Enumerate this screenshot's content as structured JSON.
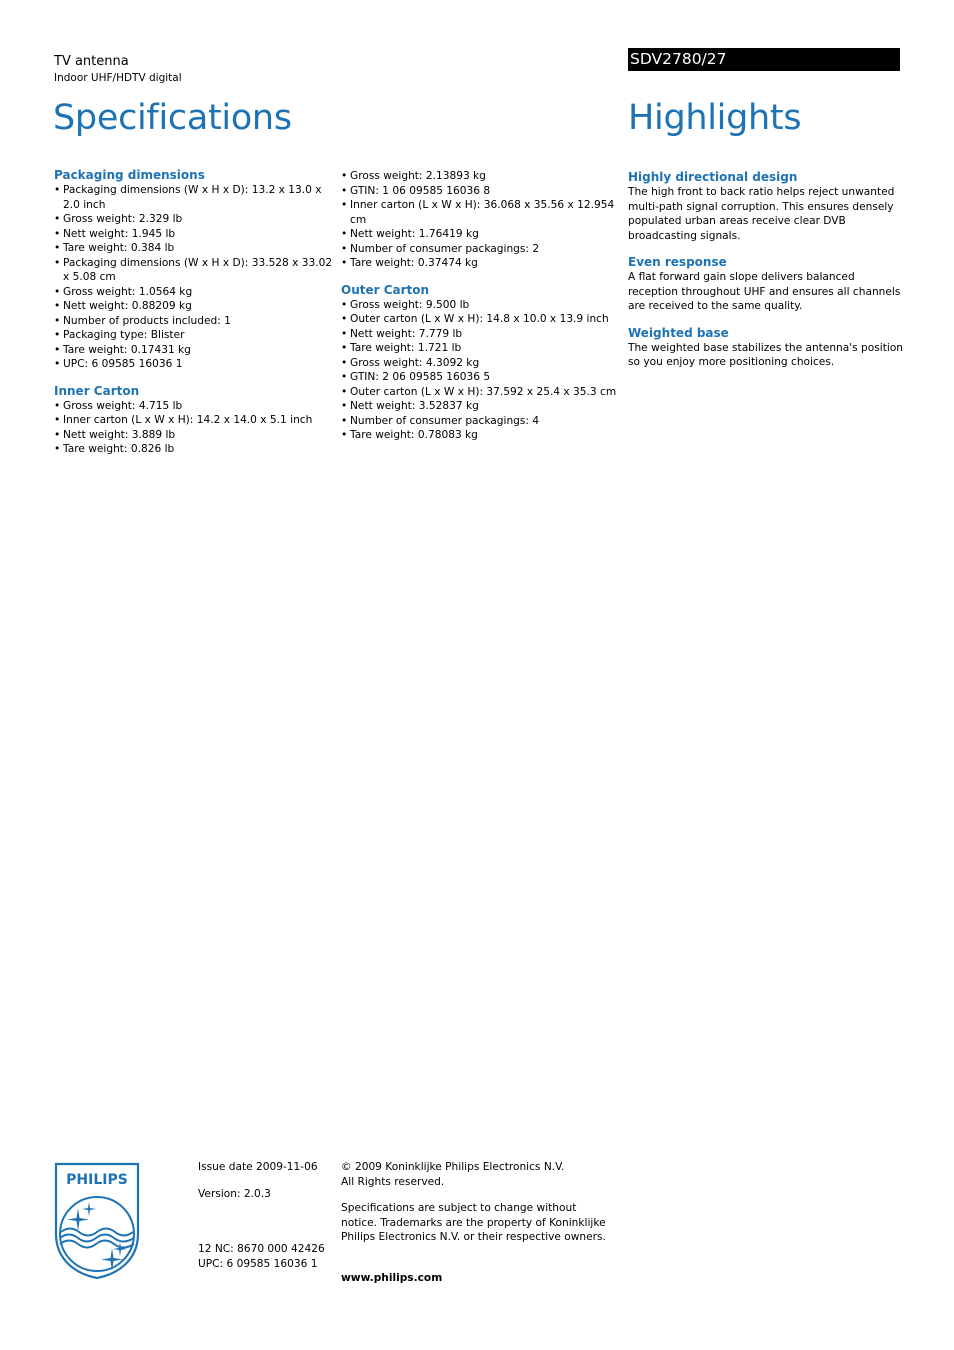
{
  "header": {
    "product_name": "TV antenna",
    "product_subtitle": "Indoor UHF/HDTV digital",
    "model": "SDV2780/27",
    "specifications_title": "Specifications",
    "highlights_title": "Highlights"
  },
  "specifications": {
    "column1": [
      {
        "title": "Packaging dimensions",
        "items": [
          "Packaging dimensions (W x H x D): 13.2 x 13.0 x 2.0 inch",
          "Gross weight: 2.329 lb",
          "Nett weight: 1.945 lb",
          "Tare weight: 0.384 lb",
          "Packaging dimensions (W x H x D): 33.528 x 33.02 x 5.08 cm",
          "Gross weight: 1.0564 kg",
          "Nett weight: 0.88209 kg",
          "Number of products included: 1",
          "Packaging type: Blister",
          "Tare weight: 0.17431 kg",
          "UPC: 6 09585 16036 1"
        ]
      },
      {
        "title": "Inner Carton",
        "items": [
          "Gross weight: 4.715 lb",
          "Inner carton (L x W x H): 14.2 x 14.0 x 5.1 inch",
          "Nett weight: 3.889 lb",
          "Tare weight: 0.826 lb"
        ]
      }
    ],
    "column2": [
      {
        "title": "",
        "items": [
          "Gross weight: 2.13893 kg",
          "GTIN: 1 06 09585 16036 8",
          "Inner carton (L x W x H): 36.068 x 35.56 x 12.954 cm",
          "Nett weight: 1.76419 kg",
          "Number of consumer packagings: 2",
          "Tare weight: 0.37474 kg"
        ]
      },
      {
        "title": "Outer Carton",
        "items": [
          "Gross weight: 9.500 lb",
          "Outer carton (L x W x H): 14.8 x 10.0 x 13.9 inch",
          "Nett weight: 7.779 lb",
          "Tare weight: 1.721 lb",
          "Gross weight: 4.3092 kg",
          "GTIN: 2 06 09585 16036 5",
          "Outer carton (L x W x H): 37.592 x 25.4 x 35.3 cm",
          "Nett weight: 3.52837 kg",
          "Number of consumer packagings: 4",
          "Tare weight: 0.78083 kg"
        ]
      }
    ]
  },
  "highlights": [
    {
      "title": "Highly directional design",
      "text": "The high front to back ratio helps reject unwanted multi-path signal corruption. This ensures densely populated urban areas receive clear DVB broadcasting signals."
    },
    {
      "title": "Even response",
      "text": "A flat forward gain slope delivers balanced reception throughout UHF and ensures all channels are received to the same quality."
    },
    {
      "title": "Weighted base",
      "text": "The weighted base stabilizes the antenna's position so you enjoy more positioning choices."
    }
  ],
  "footer": {
    "logo_text": "PHILIPS",
    "issue_date": "Issue date 2009-11-06",
    "version": "Version: 2.0.3",
    "nc": "12 NC: 8670 000 42426",
    "upc": "UPC: 6 09585 16036 1",
    "copyright_line1": "© 2009 Koninklijke Philips Electronics N.V.",
    "copyright_line2": "All Rights reserved.",
    "notice": "Specifications are subject to change without notice. Trademarks are the property of Koninklijke Philips Electronics N.V. or their respective owners.",
    "website": "www.philips.com"
  },
  "colors": {
    "brand_blue": "#1e73b4",
    "model_bar": "#000000"
  }
}
